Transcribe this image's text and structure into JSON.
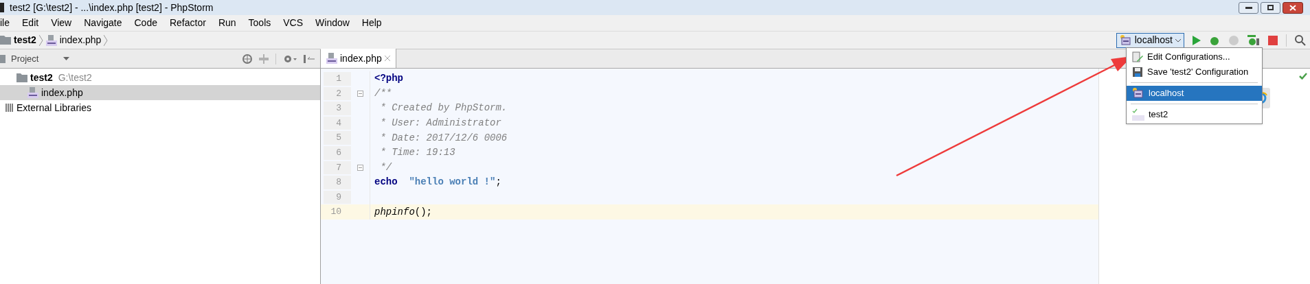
{
  "window": {
    "title": "test2 [G:\\test2] - ...\\index.php [test2] - PhpStorm"
  },
  "menu": [
    "ile",
    "Edit",
    "View",
    "Navigate",
    "Code",
    "Refactor",
    "Run",
    "Tools",
    "VCS",
    "Window",
    "Help"
  ],
  "breadcrumbs": [
    {
      "label": "test2",
      "kind": "folder"
    },
    {
      "label": "index.php",
      "kind": "file"
    }
  ],
  "run_config": {
    "label": "localhost"
  },
  "project_panel": {
    "title": "Project",
    "tree": [
      {
        "label": "test2",
        "path": "G:\\test2",
        "kind": "folder",
        "selected": false,
        "children": [
          {
            "label": "index.php",
            "kind": "file",
            "selected": true
          }
        ]
      },
      {
        "label": "External Libraries",
        "kind": "library",
        "selected": false
      }
    ]
  },
  "editor": {
    "tabs": [
      {
        "label": "index.php",
        "selected": true
      }
    ],
    "lines": [
      {
        "number": "1",
        "current": false,
        "tokens": [
          {
            "kind": "keyword",
            "text": "<?php"
          }
        ]
      },
      {
        "number": "2",
        "current": false,
        "fold": true,
        "tokens": [
          {
            "kind": "comment",
            "text": "/**"
          }
        ]
      },
      {
        "number": "3",
        "current": false,
        "tokens": [
          {
            "kind": "comment",
            "text": " * Created by PhpStorm."
          }
        ]
      },
      {
        "number": "4",
        "current": false,
        "tokens": [
          {
            "kind": "comment",
            "text": " * User: Administrator"
          }
        ]
      },
      {
        "number": "5",
        "current": false,
        "tokens": [
          {
            "kind": "comment",
            "text": " * Date: 2017/12/6 0006"
          }
        ]
      },
      {
        "number": "6",
        "current": false,
        "tokens": [
          {
            "kind": "comment",
            "text": " * Time: 19:13"
          }
        ]
      },
      {
        "number": "7",
        "current": false,
        "fold": true,
        "tokens": [
          {
            "kind": "comment",
            "text": " */"
          }
        ]
      },
      {
        "number": "8",
        "current": false,
        "tokens": [
          {
            "kind": "keyword",
            "text": "echo"
          },
          {
            "kind": "string",
            "text": "\"hello world !\""
          },
          {
            "kind": "plain",
            "text": ";"
          }
        ]
      },
      {
        "number": "9",
        "current": false
      },
      {
        "number": "10",
        "current": true,
        "tokens": [
          {
            "kind": "function",
            "text": "phpinfo"
          },
          {
            "kind": "plain",
            "text": "();"
          }
        ]
      }
    ]
  },
  "config_menu": {
    "items": [
      {
        "kind": "edit",
        "label": "Edit Configurations...",
        "selected": false
      },
      {
        "kind": "save",
        "label": "Save 'test2' Configuration",
        "selected": false
      },
      {
        "kind": "separator"
      },
      {
        "kind": "server",
        "label": "localhost",
        "selected": true
      },
      {
        "kind": "separator"
      },
      {
        "kind": "file",
        "label": "test2",
        "selected": false
      }
    ]
  }
}
